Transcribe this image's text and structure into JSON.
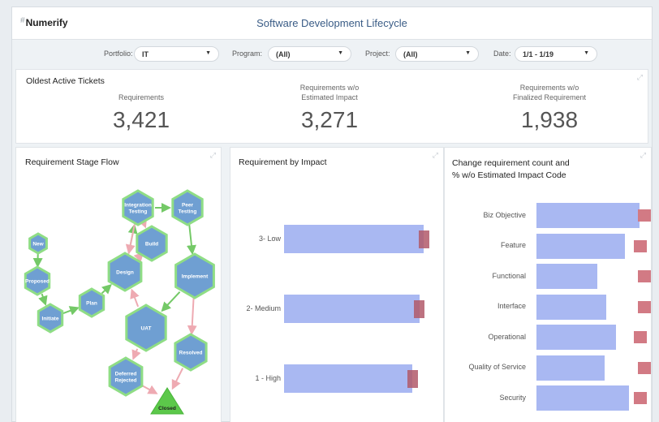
{
  "app": {
    "logo": "Numerify",
    "title": "Software Development Lifecycle"
  },
  "filters": [
    {
      "label": "Portfolio:",
      "value": "IT"
    },
    {
      "label": "Program:",
      "value": "(All)"
    },
    {
      "label": "Project:",
      "value": "(All)"
    },
    {
      "label": "Date:",
      "value": "1/1 - 1/19"
    }
  ],
  "kpis": {
    "title": "Oldest Active Tickets",
    "items": [
      {
        "label": "Requirements",
        "label2": "",
        "value": "3,421"
      },
      {
        "label": "Requirements w/o",
        "label2": "Estimated Impact",
        "value": "3,271"
      },
      {
        "label": "Requirements w/o",
        "label2": "Finalized Requirement",
        "value": "1,938"
      }
    ]
  },
  "flow": {
    "title": "Requirement Stage Flow",
    "nodes": [
      "New",
      "Proposed",
      "Initiate",
      "Plan",
      "Design",
      "Build",
      "Integration Testing",
      "Peer Testing",
      "Implement",
      "UAT",
      "Resolved",
      "Deferred Rejected",
      "Closed"
    ],
    "colors": {
      "node_fill": "#6f9fd2",
      "node_border": "#8fdd85",
      "arrow_green": "#74c967",
      "arrow_pink": "#eeaab2",
      "closed_fill": "#5cc84a"
    }
  },
  "impact": {
    "title": "Requirement by Impact",
    "categories": [
      "3- Low",
      "2- Medium",
      "1 - High"
    ],
    "bar_values": [
      1.0,
      0.97,
      0.92
    ],
    "mark_values": [
      1.0,
      0.97,
      0.92
    ]
  },
  "change": {
    "title_line1": "Change requirement count and",
    "title_line2": "% w/o Estimated Impact Code",
    "categories": [
      "Biz Objective",
      "Feature",
      "Functional",
      "Interface",
      "Operational",
      "Quality of Service",
      "Security"
    ],
    "bar_values": [
      1.0,
      0.86,
      0.59,
      0.68,
      0.77,
      0.66,
      0.9
    ],
    "mark_values": [
      1.0,
      0.84,
      1.0,
      0.99,
      0.82,
      0.99,
      0.84
    ]
  },
  "colors": {
    "bar": "#a9b8f2",
    "mark": "#d27a84",
    "mark_dark": "#b2596a",
    "title": "#3a5c86"
  }
}
